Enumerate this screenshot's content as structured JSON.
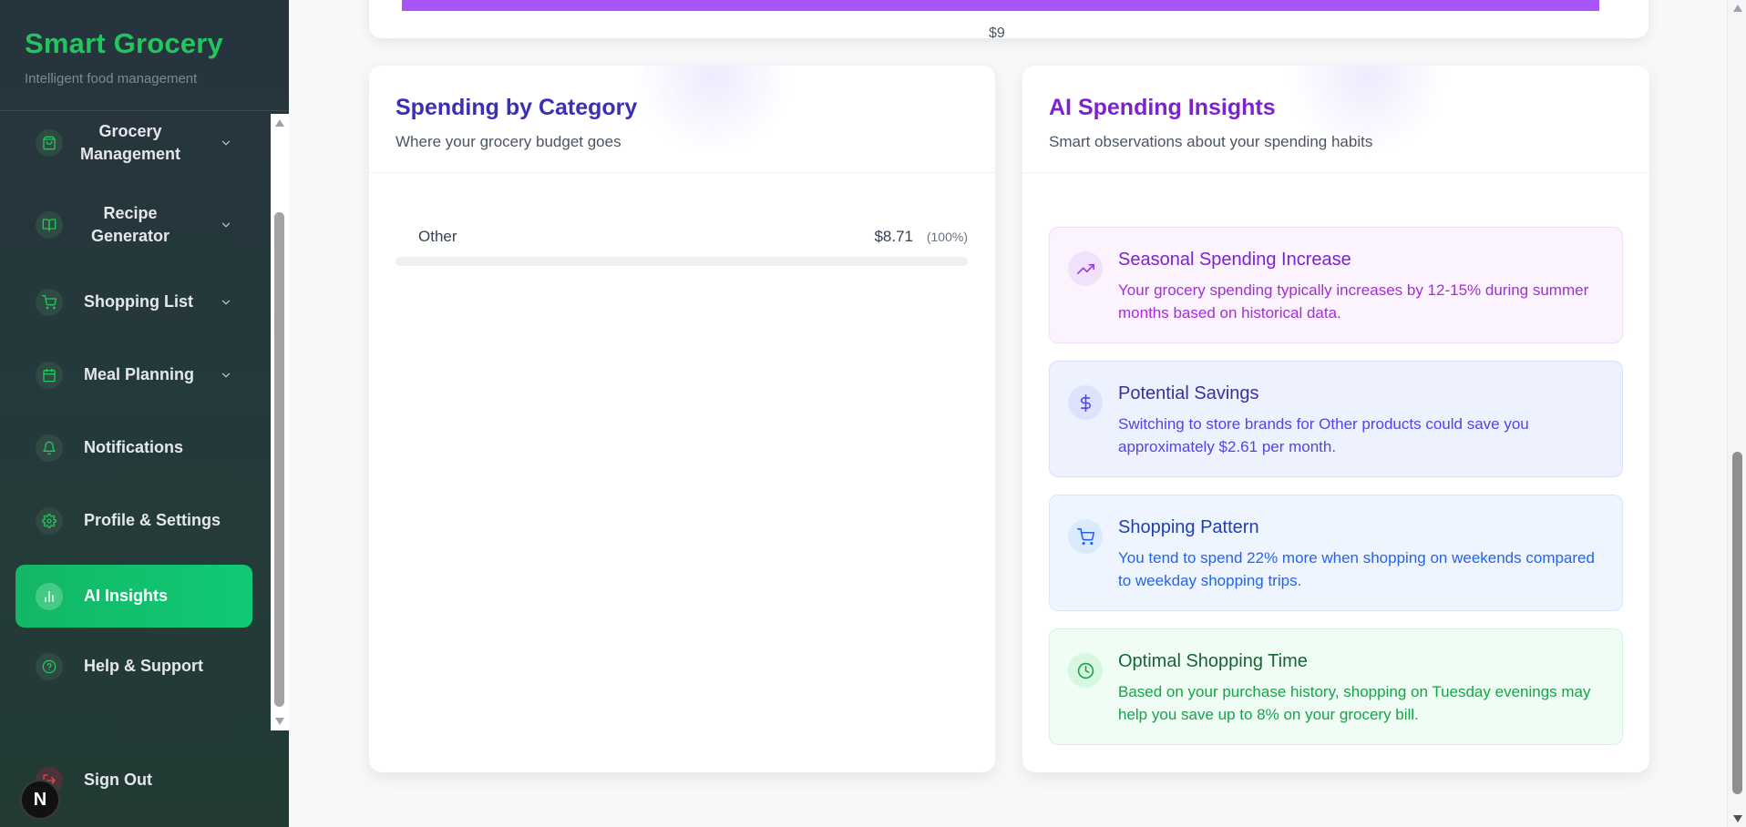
{
  "brand": {
    "title": "Smart Grocery",
    "subtitle": "Intelligent food management"
  },
  "sidebar": {
    "items": [
      {
        "label": "Grocery Management",
        "icon": "shopping-bag-icon",
        "has_chevron": true
      },
      {
        "label": "Recipe Generator",
        "icon": "book-open-icon",
        "has_chevron": true
      },
      {
        "label": "Shopping List",
        "icon": "cart-icon",
        "has_chevron": true
      },
      {
        "label": "Meal Planning",
        "icon": "calendar-icon",
        "has_chevron": true
      },
      {
        "label": "Notifications",
        "icon": "bell-icon",
        "has_chevron": false
      },
      {
        "label": "Profile & Settings",
        "icon": "gear-icon",
        "has_chevron": false
      },
      {
        "label": "AI Insights",
        "icon": "bar-chart-icon",
        "has_chevron": false,
        "active": true
      },
      {
        "label": "Help & Support",
        "icon": "help-circle-icon",
        "has_chevron": false
      }
    ],
    "sign_out": "Sign Out",
    "dev_badge": "N",
    "accent_color": "#22c55e"
  },
  "top_chart": {
    "amount_label": "$9",
    "bar_color": "#a855f7"
  },
  "spending": {
    "title": "Spending by Category",
    "subtitle": "Where your grocery budget goes",
    "categories": [
      {
        "name": "Other",
        "amount": "$8.71",
        "percent": "(100%)"
      }
    ]
  },
  "insights": {
    "title": "AI Spending Insights",
    "subtitle": "Smart observations about your spending habits",
    "items": [
      {
        "title": "Seasonal Spending Increase",
        "body": "Your grocery spending typically increases by 12-15% during summer months based on historical data.",
        "icon": "trending-up-icon",
        "color": "#9333ea"
      },
      {
        "title": "Potential Savings",
        "body": "Switching to store brands for Other products could save you approximately $2.61 per month.",
        "icon": "dollar-icon",
        "color": "#4f46e5"
      },
      {
        "title": "Shopping Pattern",
        "body": "You tend to spend 22% more when shopping on weekends compared to weekday shopping trips.",
        "icon": "cart-icon",
        "color": "#2563eb"
      },
      {
        "title": "Optimal Shopping Time",
        "body": "Based on your purchase history, shopping on Tuesday evenings may help you save up to 8% on your grocery bill.",
        "icon": "clock-icon",
        "color": "#16a34a"
      }
    ]
  }
}
